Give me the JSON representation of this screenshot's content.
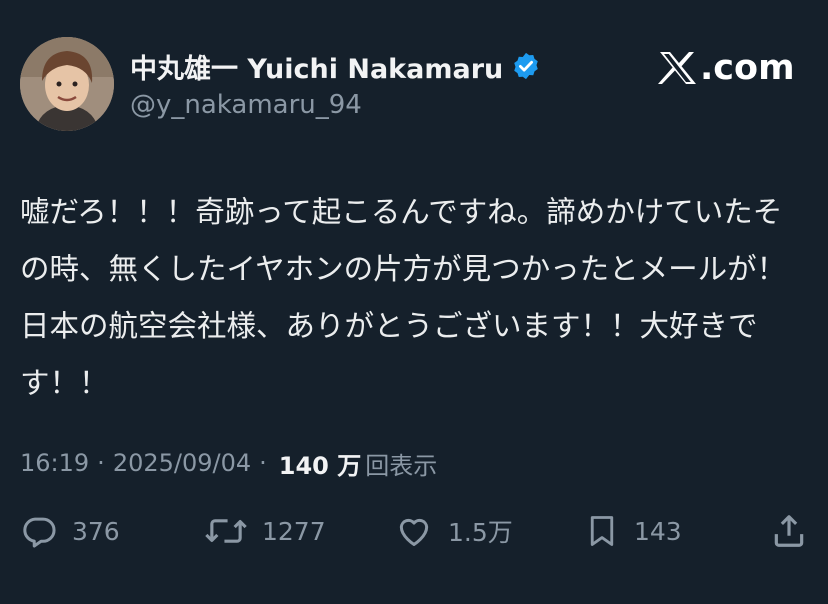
{
  "author": {
    "display_name": "中丸雄一 Yuichi Nakamaru",
    "handle": "@y_nakamaru_94",
    "verified": true
  },
  "brand": {
    "label": ".com",
    "icon": "x-logo-icon"
  },
  "tweet": {
    "text": "嘘だろ！！！奇跡って起こるんですね。諦めかけていたその時、無くしたイヤホンの片方が見つかったとメールが！日本の航空会社様、ありがとうございます！！大好きです！！"
  },
  "meta": {
    "time": "16:19",
    "separator": "·",
    "date": "2025/09/04",
    "views_count": "140 万",
    "views_label": "回表示"
  },
  "actions": {
    "replies": "376",
    "reposts": "1277",
    "likes": "1.5万",
    "bookmarks": "143"
  },
  "colors": {
    "background": "#15202b",
    "text": "#e7e9ea",
    "muted": "#8b98a5",
    "verified": "#1d9bf0"
  }
}
